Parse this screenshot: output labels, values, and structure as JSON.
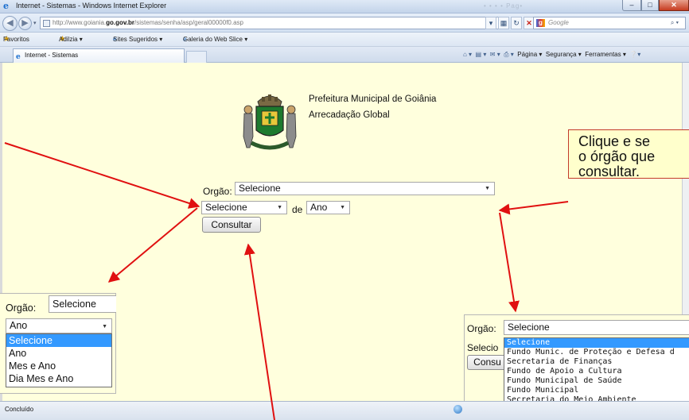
{
  "window": {
    "title": "Internet - Sistemas - Windows Internet Explorer",
    "faint_title": "• • • • Pag•"
  },
  "address": {
    "url_prefix": "http://www.goiania.",
    "url_domain": "go.gov.br",
    "url_path": "/sistemas/senha/asp/geral00000f0.asp",
    "search_placeholder": "Google"
  },
  "favorites": {
    "label": "Favoritos",
    "items": [
      "Adilzia ▾",
      "Sites Sugeridos ▾",
      "Galeria do Web Slice ▾"
    ]
  },
  "tab": {
    "title": "Internet - Sistemas"
  },
  "commandbar": {
    "items": [
      "Página ▾",
      "Segurança ▾",
      "Ferramentas ▾"
    ]
  },
  "header": {
    "name": "Prefeitura Municipal de Goiânia",
    "subtitle": "Arrecadação Global"
  },
  "form": {
    "orgao_label": "Orgão:",
    "orgao_value": "Selecione",
    "periodo_value": "Selecione",
    "de_label": "de",
    "ano_value": "Ano",
    "consultar_label": "Consultar"
  },
  "callout": {
    "lines": [
      "Clique e se",
      "o órgão que",
      "consultar."
    ]
  },
  "inset_left": {
    "orgao_label": "Orgão:",
    "orgao_value": "Selecione",
    "current": "Ano",
    "options": [
      "Selecione",
      "Ano",
      "Mes e Ano",
      "Dia Mes e Ano"
    ]
  },
  "inset_right": {
    "orgao_label": "Orgão:",
    "orgao_value": "Selecione",
    "partial_select": "Selecio",
    "partial_button": "Consu",
    "options": [
      "Selecione",
      "Fundo Munic. de Proteção e Defesa d",
      "Secretaria de Finanças",
      "Fundo de Apoio a Cultura",
      "Fundo Municipal de Saúde",
      "Fundo Municipal",
      "Secretaria do Meio Ambiente"
    ]
  },
  "status": {
    "text": "Concluído"
  },
  "colors": {
    "page_bg": "#ffffdd",
    "arrow": "#e01010",
    "highlight": "#3399ff"
  }
}
